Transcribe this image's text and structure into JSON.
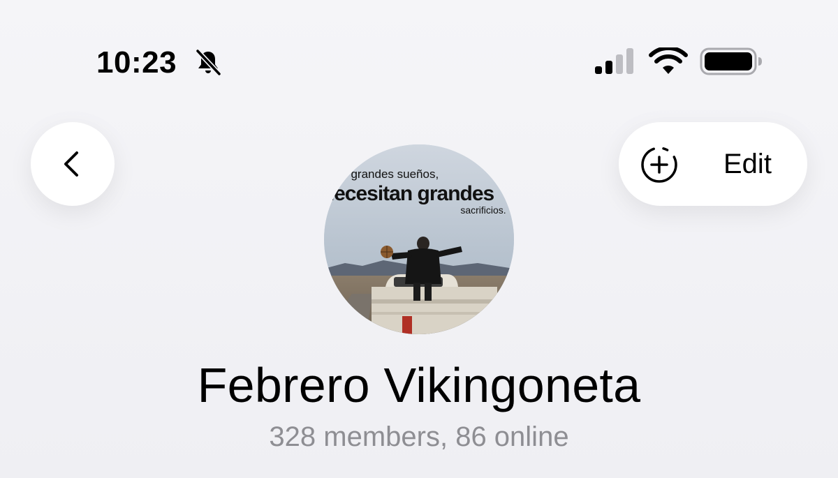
{
  "status_bar": {
    "time": "10:23",
    "icons": [
      "bell-slash-icon",
      "cellular-signal-icon",
      "wifi-icon",
      "battery-icon"
    ],
    "signal_bars_active": 2,
    "signal_bars_total": 4
  },
  "nav": {
    "back_icon": "chevron-left-icon",
    "add_story_icon": "dashed-circle-plus-icon",
    "edit_label": "Edit"
  },
  "group": {
    "avatar_caption": {
      "line1": "os grandes sueños,",
      "line2": "necesitan grandes",
      "line3": "sacrificios."
    },
    "name": "Febrero Vikingoneta",
    "subtitle": "328 members, 86 online"
  },
  "colors": {
    "background": "#f3f3f6",
    "button_bg": "#ffffff",
    "subtitle_gray": "#8e8e93",
    "text": "#000000"
  }
}
